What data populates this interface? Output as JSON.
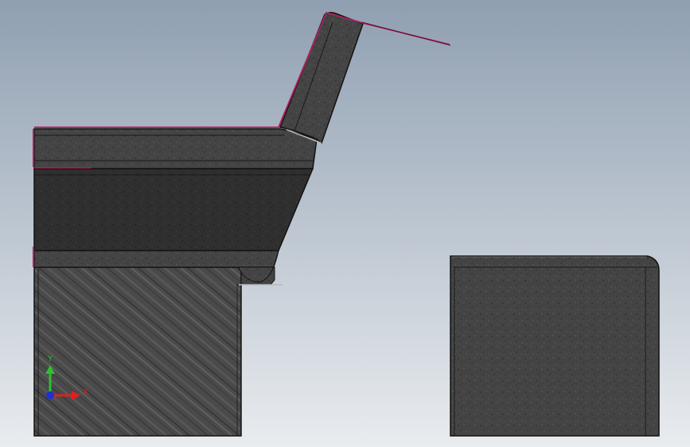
{
  "viewport": {
    "background_top": "#8f9fb1",
    "background_bottom": "#e9ecef"
  },
  "colors": {
    "stone": "#3f3f3f",
    "stone_dark": "#2a2a2a",
    "stone_light": "#5a5a5a",
    "edge": "#121212",
    "highlight": "#b8b8b8",
    "accent_edge": "#b0205c"
  },
  "triad": {
    "y_label": "Y",
    "x_label": "X",
    "y_color": "#2fbf2f",
    "x_color": "#e02020",
    "z_color": "#2030d0"
  }
}
